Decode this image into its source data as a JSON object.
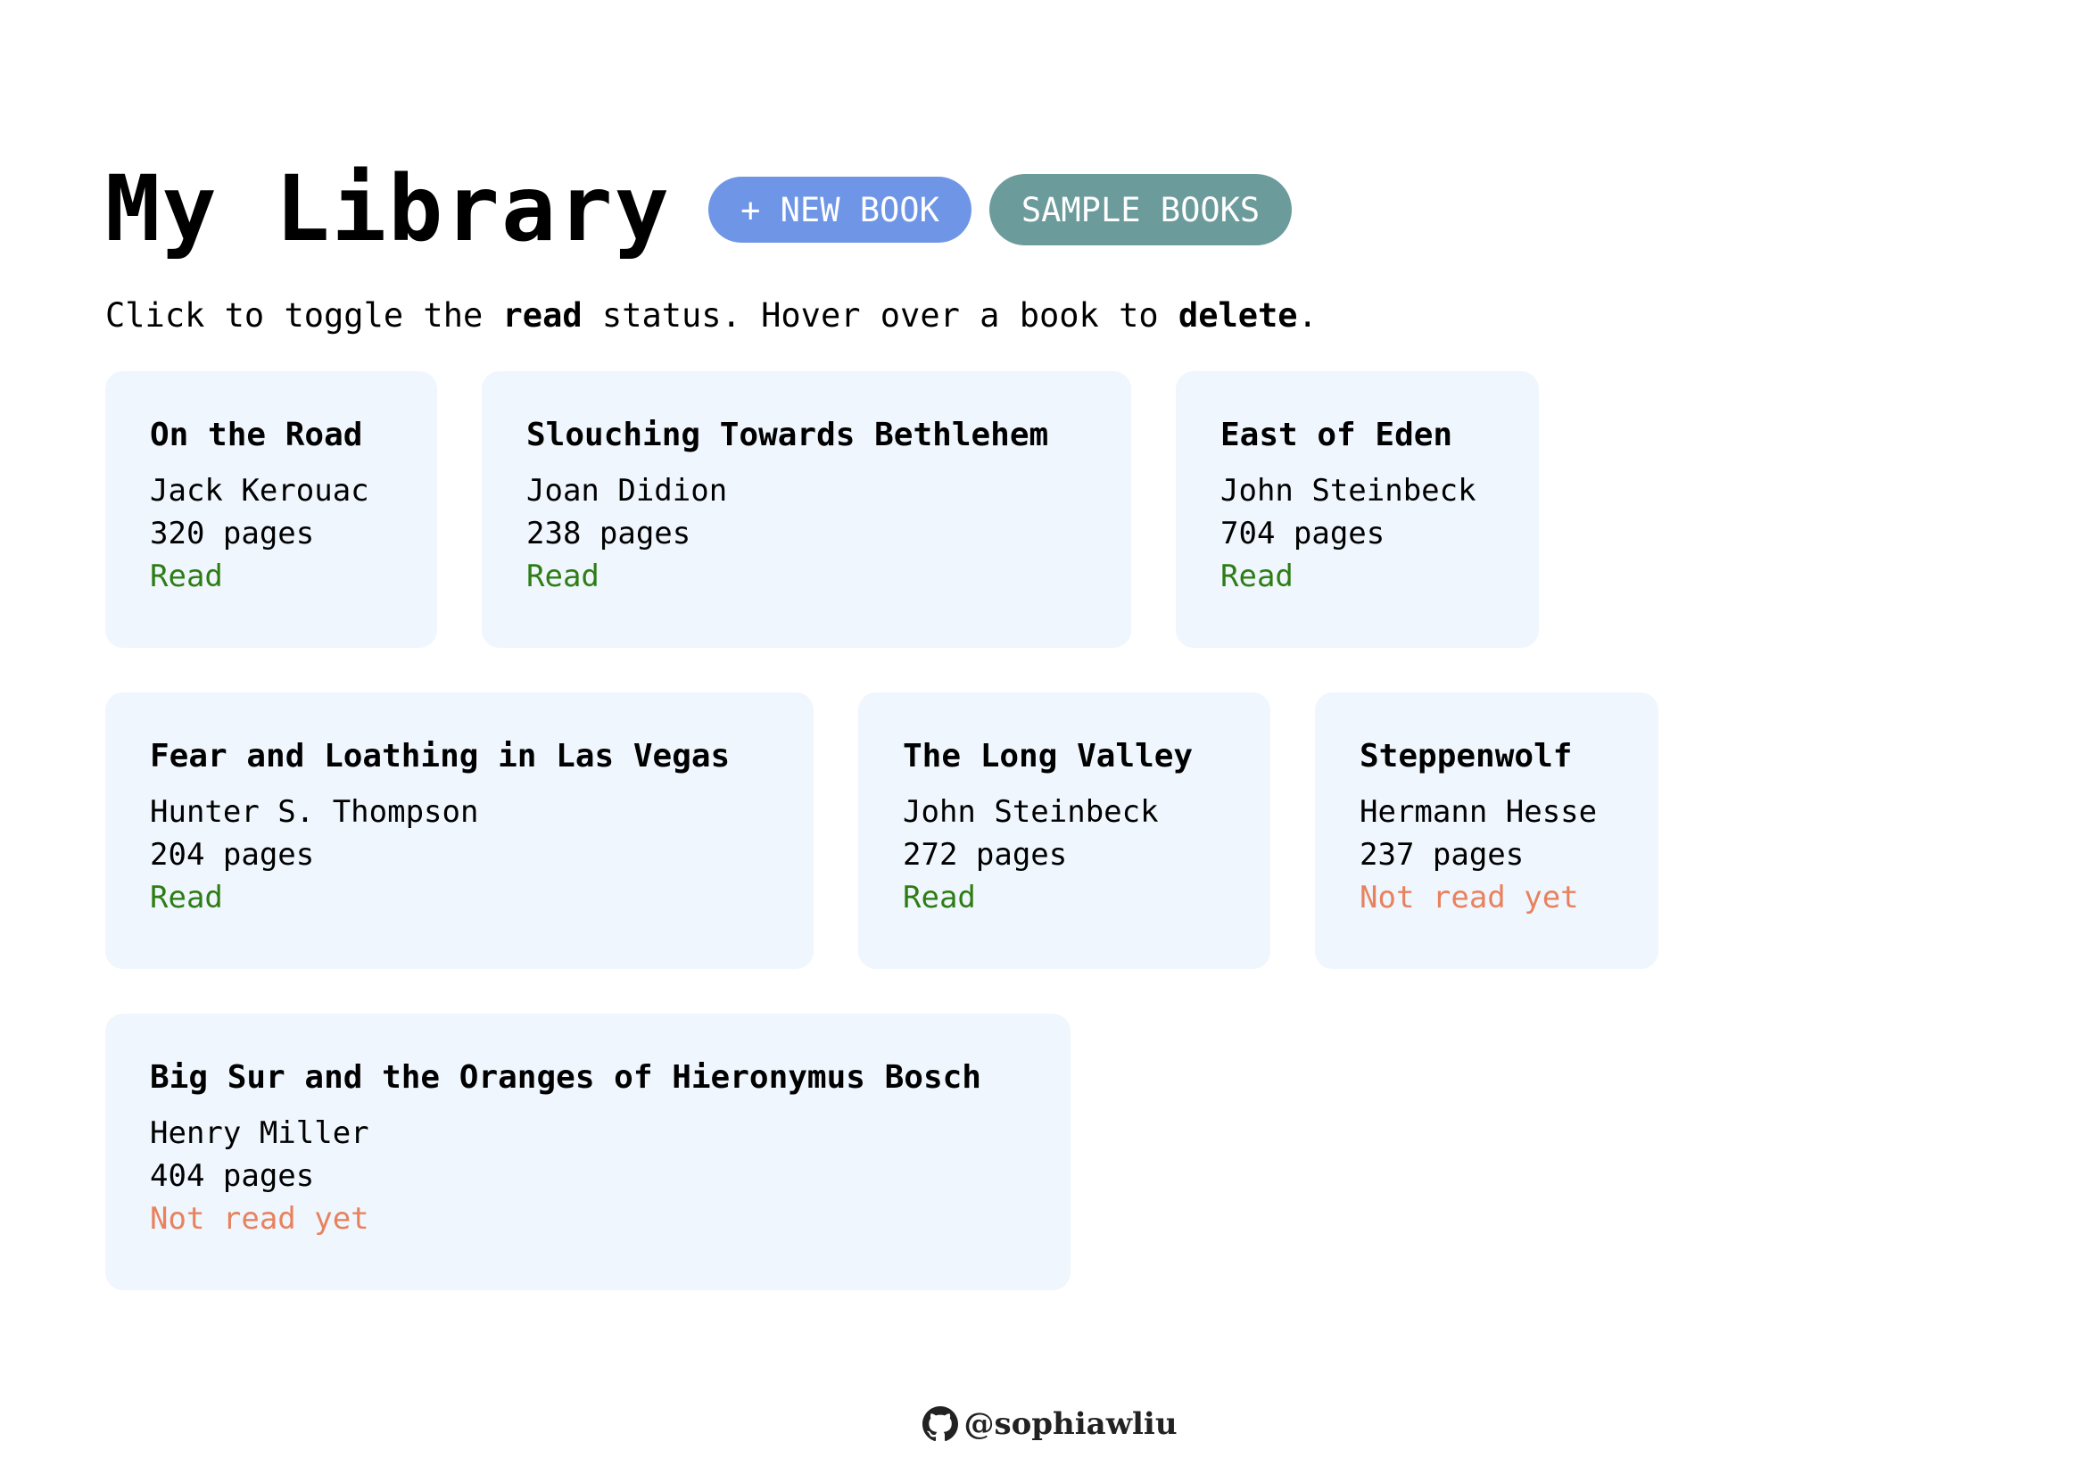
{
  "header": {
    "title": "My Library",
    "new_book_label": "+ NEW BOOK",
    "sample_books_label": "SAMPLE BOOKS"
  },
  "instructions": {
    "part1": "Click to toggle the ",
    "read_word": "read",
    "part2": " status. Hover over a book to ",
    "delete_word": "delete",
    "part3": "."
  },
  "books": [
    {
      "title": "On the Road",
      "author": "Jack Kerouac",
      "pages": "320 pages",
      "status": "Read"
    },
    {
      "title": "Slouching Towards Bethlehem",
      "author": "Joan Didion",
      "pages": "238 pages",
      "status": "Read"
    },
    {
      "title": "East of Eden",
      "author": "John Steinbeck",
      "pages": "704 pages",
      "status": "Read"
    },
    {
      "title": "Fear and Loathing in Las Vegas",
      "author": "Hunter S. Thompson",
      "pages": "204 pages",
      "status": "Read"
    },
    {
      "title": "The Long Valley",
      "author": "John Steinbeck",
      "pages": "272 pages",
      "status": "Read"
    },
    {
      "title": "Steppenwolf",
      "author": "Hermann Hesse",
      "pages": "237 pages",
      "status": "Not read yet"
    },
    {
      "title": "Big Sur and the Oranges of Hieronymus Bosch",
      "author": "Henry Miller",
      "pages": "404 pages",
      "status": "Not read yet"
    }
  ],
  "footer": {
    "handle": "@sophiawliu",
    "icon": "github-icon"
  },
  "colors": {
    "new_book_button": "#6f96e6",
    "sample_books_button": "#6c9b9c",
    "card_background": "#eff6fd",
    "read_status": "#2e7d14",
    "not_read_status": "#e8825e"
  }
}
